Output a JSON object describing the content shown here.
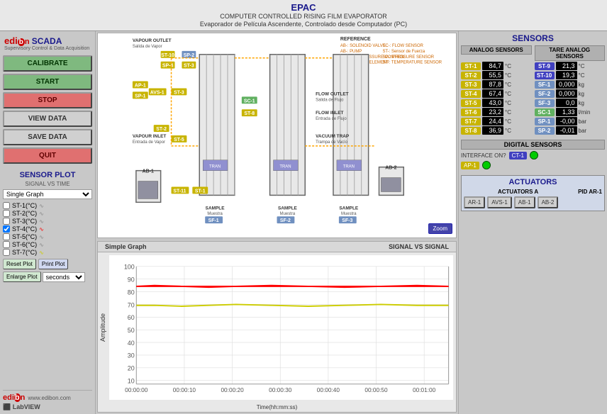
{
  "header": {
    "title": "EPAC",
    "subtitle1": "COMPUTER CONTROLLED RISING FILM EVAPORATOR",
    "subtitle2": "Evaporador de Película Ascendente, Controlado desde Computador (PC)"
  },
  "logo": {
    "name": "edibon SCADA",
    "sub": "Supervisory Control & Data Acquisition",
    "url": "www.edibon.com"
  },
  "buttons": {
    "calibrate": "CALIBRATE",
    "start": "START",
    "stop": "STOP",
    "view_data": "VIEW DATA",
    "save_data": "SAVE DATA",
    "quit": "QUIT"
  },
  "sensor_plot": {
    "title": "SENSOR PLOT",
    "signal_vs_time": "SIGNAL VS TIME",
    "signal_vs_signal": "SIGNAL VS SIGNAL",
    "graph_type": "Single Graph",
    "sensors": [
      {
        "id": "ST-1(°C)",
        "checked": false,
        "wave": "~"
      },
      {
        "id": "ST-2(°C)",
        "checked": false,
        "wave": "~"
      },
      {
        "id": "ST-3(°C)",
        "checked": false,
        "wave": "~"
      },
      {
        "id": "ST-4(°C)",
        "checked": true,
        "wave": "~",
        "color": "red"
      },
      {
        "id": "ST-5(°C)",
        "checked": false,
        "wave": "~"
      },
      {
        "id": "ST-6(°C)",
        "checked": false,
        "wave": "~"
      },
      {
        "id": "ST-7(°C)",
        "checked": false,
        "wave": "~"
      }
    ],
    "reset_plot": "Reset Plot",
    "print_plot": "Print Plot",
    "enlarge_plot": "Enlarge Plot",
    "seconds": "seconds"
  },
  "sensors": {
    "title": "SENSORS",
    "analog_header": "ANALOG SENSORS",
    "tare_header": "TARE ANALOG SENSORS",
    "analog": [
      {
        "id": "ST-1",
        "value": "84,7",
        "unit": "°C"
      },
      {
        "id": "ST-2",
        "value": "55,5",
        "unit": "°C"
      },
      {
        "id": "ST-3",
        "value": "87,8",
        "unit": "°C"
      },
      {
        "id": "ST-4",
        "value": "67,4",
        "unit": "°C"
      },
      {
        "id": "ST-5",
        "value": "43,0",
        "unit": "°C"
      },
      {
        "id": "ST-6",
        "value": "23,2",
        "unit": "°C"
      },
      {
        "id": "ST-7",
        "value": "24,4",
        "unit": "°C"
      },
      {
        "id": "ST-8",
        "value": "36,9",
        "unit": "°C"
      }
    ],
    "tare": [
      {
        "id": "ST-9",
        "value": "21,3",
        "unit": "°C"
      },
      {
        "id": "ST-10",
        "value": "19,3",
        "unit": "°C"
      },
      {
        "id": "SF-1",
        "value": "0,000",
        "unit": "kg"
      },
      {
        "id": "SF-2",
        "value": "0,000",
        "unit": "kg"
      },
      {
        "id": "SF-3",
        "value": "0,0",
        "unit": "kg"
      },
      {
        "id": "SC-1",
        "value": "1,33",
        "unit": "l/min"
      },
      {
        "id": "SP-1",
        "value": "-0,00",
        "unit": "bar"
      },
      {
        "id": "SP-2",
        "value": "-0,01",
        "unit": "bar"
      }
    ],
    "digital_title": "DIGITAL SENSORS",
    "interface_label": "INTERFACE ON?",
    "ct1_label": "CT-1",
    "ap1_label": "AP-1"
  },
  "actuators": {
    "title": "ACTUATORS",
    "actuators_a_title": "ACTUATORS A",
    "pid_title": "PID AR-1",
    "buttons": [
      "AR-1",
      "AVS-1",
      "AB-1",
      "AB-2"
    ]
  },
  "diagram": {
    "vapour_outlet": "VAPOUR OUTLET\nSalida de Vapor",
    "vapour_inlet": "VAPOUR INLET\nEntrada de Vapor",
    "flow_outlet": "FLOW OUTLET\nSalida de Flujo",
    "flow_inlet": "FLOW INLET\nEntrada de Flujo",
    "vacuum_trap": "VACUUM TRAP\nTrompa de Vacío",
    "zoom_btn": "Zoom",
    "sample1": "SAMPLE\nMuestra",
    "sample2": "SAMPLE\nMuestra",
    "sample3": "SAMPLE\nMuestra"
  },
  "graph": {
    "y_label": "Amplitude",
    "x_label": "Time(hh:mm:ss)",
    "simple_graph": "Simple Graph",
    "time_labels": [
      "00:00:00",
      "00:00:10",
      "00:00:20",
      "00:00:30",
      "00:00:40",
      "00:00:50",
      "00:01:00"
    ],
    "y_values": [
      "100",
      "90",
      "80",
      "70",
      "60",
      "50",
      "40",
      "30",
      "20",
      "10"
    ],
    "series": [
      {
        "color": "red",
        "y_pct": 0.83
      },
      {
        "color": "#cccc00",
        "y_pct": 0.67
      }
    ]
  }
}
